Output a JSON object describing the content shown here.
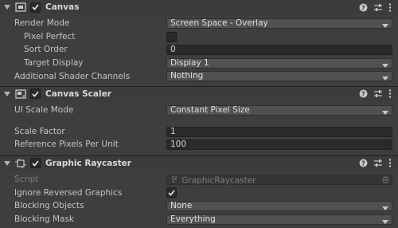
{
  "components": {
    "canvas": {
      "title": "Canvas",
      "enabled": true,
      "render_mode_label": "Render Mode",
      "render_mode_value": "Screen Space - Overlay",
      "pixel_perfect_label": "Pixel Perfect",
      "pixel_perfect_value": false,
      "sort_order_label": "Sort Order",
      "sort_order_value": "0",
      "target_display_label": "Target Display",
      "target_display_value": "Display 1",
      "shader_channels_label": "Additional Shader Channels",
      "shader_channels_value": "Nothing"
    },
    "canvas_scaler": {
      "title": "Canvas Scaler",
      "enabled": true,
      "ui_scale_mode_label": "UI Scale Mode",
      "ui_scale_mode_value": "Constant Pixel Size",
      "scale_factor_label": "Scale Factor",
      "scale_factor_value": "1",
      "ref_ppu_label": "Reference Pixels Per Unit",
      "ref_ppu_value": "100"
    },
    "graphic_raycaster": {
      "title": "Graphic Raycaster",
      "enabled": true,
      "script_label": "Script",
      "script_value": "GraphicRaycaster",
      "ignore_reversed_label": "Ignore Reversed Graphics",
      "ignore_reversed_value": true,
      "blocking_objects_label": "Blocking Objects",
      "blocking_objects_value": "None",
      "blocking_mask_label": "Blocking Mask",
      "blocking_mask_value": "Everything"
    }
  },
  "icons": {
    "help": "help-icon",
    "presets": "presets-icon",
    "menu": "kebab-menu-icon"
  },
  "colors": {
    "background": "#3e3e3e",
    "header": "#3c3c3c",
    "field": "#2a2a2a",
    "dropdown": "#515151",
    "text": "#c4c4c4"
  }
}
